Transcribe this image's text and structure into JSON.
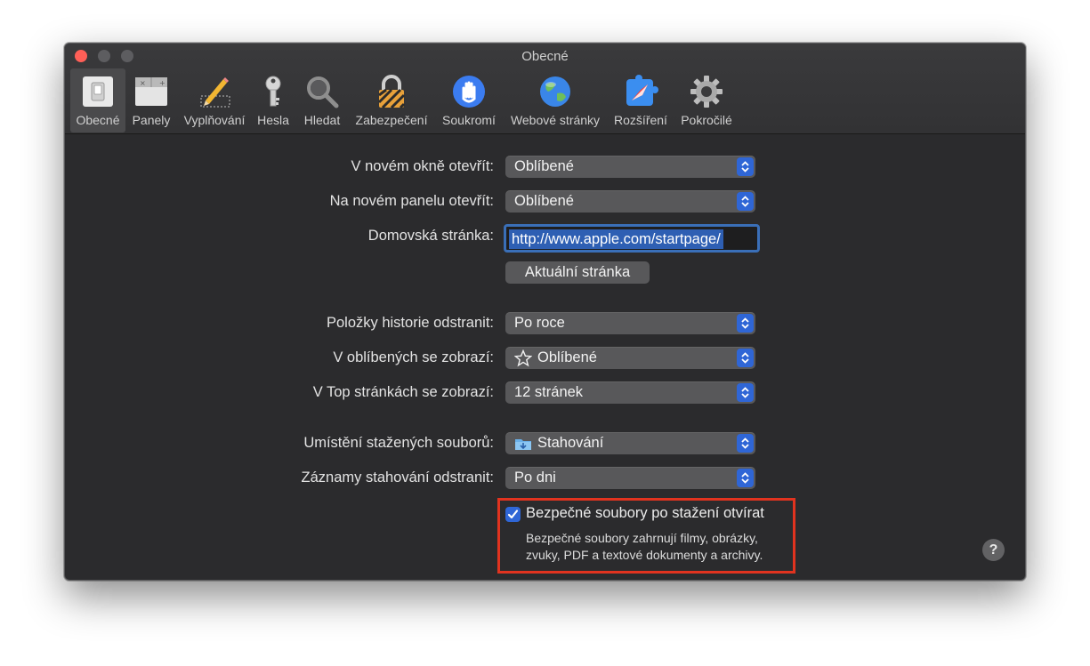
{
  "window": {
    "title": "Obecné"
  },
  "toolbar": [
    {
      "label": "Obecné",
      "icon": "general-switch-icon",
      "selected": true
    },
    {
      "label": "Panely",
      "icon": "tabs-icon"
    },
    {
      "label": "Vyplňování",
      "icon": "autofill-pencil-icon"
    },
    {
      "label": "Hesla",
      "icon": "key-icon"
    },
    {
      "label": "Hledat",
      "icon": "magnifier-icon"
    },
    {
      "label": "Zabezpečení",
      "icon": "lock-icon"
    },
    {
      "label": "Soukromí",
      "icon": "hand-icon"
    },
    {
      "label": "Webové stránky",
      "icon": "globe-icon"
    },
    {
      "label": "Rozšíření",
      "icon": "compass-puzzle-icon"
    },
    {
      "label": "Pokročilé",
      "icon": "gear-icon"
    }
  ],
  "settings": {
    "new_window": {
      "label": "V novém okně otevřít:",
      "value": "Oblíbené"
    },
    "new_tab": {
      "label": "Na novém panelu otevřít:",
      "value": "Oblíbené"
    },
    "homepage": {
      "label": "Domovská stránka:",
      "value": "http://www.apple.com/startpage/"
    },
    "current_page_button": "Aktuální stránka",
    "history_remove": {
      "label": "Položky historie odstranit:",
      "value": "Po roce"
    },
    "favorites_show": {
      "label": "V oblíbených se zobrazí:",
      "value": "Oblíbené",
      "icon": "star-icon"
    },
    "top_sites_show": {
      "label": "V Top stránkách se zobrazí:",
      "value": "12 stránek"
    },
    "download_location": {
      "label": "Umístění stažených souborů:",
      "value": "Stahování",
      "icon": "downloads-folder-icon"
    },
    "download_remove": {
      "label": "Záznamy stahování odstranit:",
      "value": "Po dni"
    },
    "open_safe_files": {
      "label": "Bezpečné soubory po stažení otvírat",
      "checked": true,
      "description_line1": "Bezpečné soubory zahrnují filmy, obrázky,",
      "description_line2": "zvuky, PDF a textové dokumenty a archivy."
    }
  },
  "help": {
    "label": "?"
  },
  "colors": {
    "accent": "#2f66d6",
    "highlight_border": "#e1331f",
    "window_bg": "#2b2b2d"
  }
}
